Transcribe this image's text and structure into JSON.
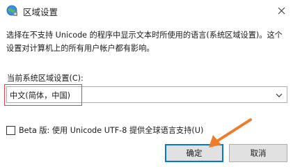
{
  "window": {
    "title": "区域设置",
    "icon": "globe-settings-icon",
    "close_icon": "close-icon"
  },
  "description": "选择在不支持 Unicode 的程序中显示文本时所使用的语言(系统区域设置)。这个设置对计算机上的所有用户帐户都有影响。",
  "locale": {
    "label": "当前系统区域设置(C):",
    "selected": "中文(简体，中国)"
  },
  "beta": {
    "label": "Beta 版: 使用 Unicode UTF-8 提供全球语言支持(U)",
    "checked": false
  },
  "buttons": {
    "ok": "确定",
    "cancel": "取消"
  },
  "annotation_colors": {
    "highlight_box": "#e0414e",
    "arrow": "#f07b28"
  }
}
